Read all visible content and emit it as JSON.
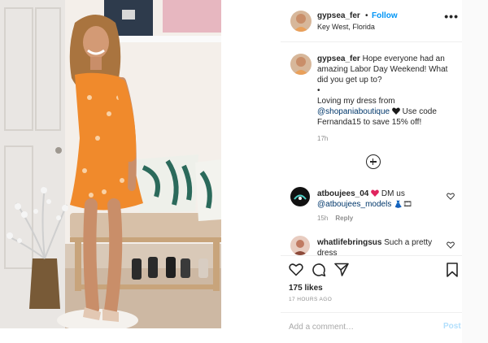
{
  "post": {
    "username": "gypsea_fer",
    "separator": "•",
    "follow_label": "Follow",
    "location": "Key West, Florida",
    "more_label": "•••",
    "image_alt": "Woman in orange floral off-shoulder dress standing near a bench"
  },
  "caption": {
    "username": "gypsea_fer",
    "line1": " Hope everyone had an amazing Labor Day Weekend! What did you get up to?",
    "bullet": "•",
    "line2": "Loving my dress from ",
    "mention": "@shopaniaboutique",
    "line3": " Use code Fernanda15 to save 15% off!",
    "time": "17h"
  },
  "comments": [
    {
      "username": "atboujees_04",
      "text": " DM us ",
      "mention": "@atboujees_models",
      "time": "15h",
      "reply_label": "Reply"
    },
    {
      "username": "whatlifebringsus",
      "text": " Such a pretty dress"
    }
  ],
  "actions": {
    "likes": "175 likes",
    "posted_time": "17 HOURS AGO"
  },
  "add_comment": {
    "placeholder": "Add a comment…",
    "post_label": "Post"
  },
  "colors": {
    "link_blue": "#0095f6",
    "mention_blue": "#00376b",
    "secondary_text": "#8e8e8e",
    "dress_orange": "#f08a2c"
  }
}
